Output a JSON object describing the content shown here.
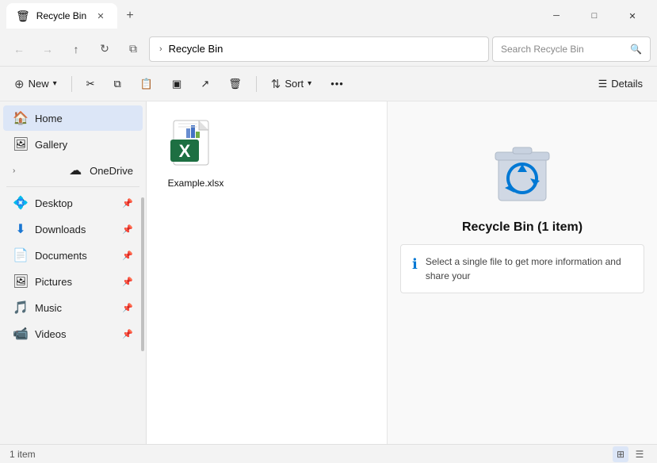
{
  "window": {
    "title": "Recycle Bin",
    "tab_label": "Recycle Bin",
    "close_label": "✕",
    "add_tab_label": "+",
    "minimize_label": "─",
    "maximize_label": "□",
    "winclose_label": "✕"
  },
  "nav": {
    "back_icon": "←",
    "forward_icon": "→",
    "up_icon": "↑",
    "refresh_icon": "↻",
    "desktops_icon": "⧉",
    "chevron": "›",
    "path": "Recycle Bin",
    "search_placeholder": "Search Recycle Bin",
    "search_icon": "🔍"
  },
  "toolbar": {
    "new_label": "New",
    "new_icon": "⊕",
    "cut_icon": "✂",
    "copy_icon": "⧉",
    "paste_icon": "📋",
    "rename_icon": "▣",
    "share_icon": "↗",
    "delete_icon": "🗑",
    "sort_label": "Sort",
    "sort_icon": "⇅",
    "more_icon": "···",
    "details_icon": "☰",
    "details_label": "Details"
  },
  "sidebar": {
    "items": [
      {
        "id": "home",
        "icon": "🏠",
        "label": "Home",
        "active": true,
        "expandable": false,
        "pinnable": false
      },
      {
        "id": "gallery",
        "icon": "🖼",
        "label": "Gallery",
        "active": false,
        "expandable": false,
        "pinnable": false
      },
      {
        "id": "onedrive",
        "icon": "☁",
        "label": "OneDrive",
        "active": false,
        "expandable": true,
        "pinnable": false
      },
      {
        "id": "desktop",
        "icon": "💠",
        "label": "Desktop",
        "active": false,
        "expandable": false,
        "pinnable": true
      },
      {
        "id": "downloads",
        "icon": "⬇",
        "label": "Downloads",
        "active": false,
        "expandable": false,
        "pinnable": true
      },
      {
        "id": "documents",
        "icon": "📄",
        "label": "Documents",
        "active": false,
        "expandable": false,
        "pinnable": true
      },
      {
        "id": "pictures",
        "icon": "🖼",
        "label": "Pictures",
        "active": false,
        "expandable": false,
        "pinnable": true
      },
      {
        "id": "music",
        "icon": "🎵",
        "label": "Music",
        "active": false,
        "expandable": false,
        "pinnable": true
      },
      {
        "id": "videos",
        "icon": "📹",
        "label": "Videos",
        "active": false,
        "expandable": false,
        "pinnable": true
      }
    ]
  },
  "files": [
    {
      "name": "Example.xlsx",
      "type": "excel"
    }
  ],
  "details": {
    "title": "Recycle Bin (1 item)",
    "info_text": "Select a single file to get more information and share your"
  },
  "status": {
    "count": "1 item",
    "view_grid_icon": "⊞",
    "view_list_icon": "☰"
  }
}
